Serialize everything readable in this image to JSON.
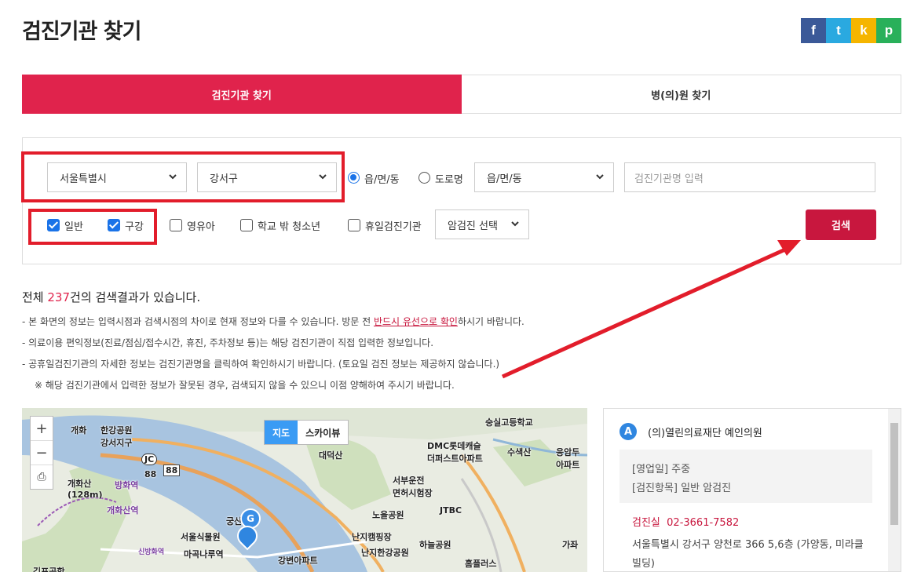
{
  "page": {
    "title": "검진기관 찾기"
  },
  "share": [
    "f",
    "t",
    "k",
    "p"
  ],
  "share_colors": {
    "facebook": "#3b5998",
    "twitter": "#2aa9e0",
    "kakaostory": "#f5b500",
    "print": "#29b05a"
  },
  "tabs": [
    {
      "label": "검진기관 찾기",
      "active": true
    },
    {
      "label": "병(의)원 찾기",
      "active": false
    }
  ],
  "search": {
    "city": "서울특별시",
    "district": "강서구",
    "addr_type_1": "읍/면/동",
    "addr_type_2": "도로명",
    "town": "읍/면/동",
    "name_placeholder": "검진기관명 입력",
    "checks": [
      {
        "label": "일반",
        "checked": true
      },
      {
        "label": "구강",
        "checked": true
      },
      {
        "label": "영유아",
        "checked": false
      },
      {
        "label": "학교 밖 청소년",
        "checked": false
      },
      {
        "label": "휴일검진기관",
        "checked": false
      }
    ],
    "cancer": "암검진 선택",
    "button": "검색"
  },
  "result": {
    "prefix": "전체 ",
    "count": "237",
    "suffix": "건의 검색결과가 있습니다."
  },
  "notes": {
    "n1_a": "- 본 화면의 정보는 입력시점과 검색시점의 차이로 현재 정보와 다를 수 있습니다.  방문 전 ",
    "n1_u": "반드시 유선으로 확인",
    "n1_b": "하시기 바랍니다.",
    "n2": "- 의료이용 편익정보(진료/점심/접수시간, 휴진, 주차정보 등)는 해당 검진기관이 직접 입력한 정보입니다.",
    "n3": "- 공휴일검진기관의 자세한 정보는 검진기관명을 클릭하여 확인하시기 바랍니다. (토요일 검진 정보는 제공하지 않습니다.)",
    "n4": "※ 해당 검진기관에서 입력한 정보가 잘못된 경우, 검색되지 않을 수 있으니 이점 양해하여 주시기 바랍니다."
  },
  "map": {
    "zoom_in": "+",
    "zoom_out": "−",
    "print": "⎙",
    "type_map": "지도",
    "type_sky": "스카이뷰",
    "labels": {
      "l1": "개화",
      "l2": "한강공원\n강서지구",
      "l3": "JC",
      "l4": "88",
      "l5": "88",
      "l6": "개화산\n(128m)",
      "l7": "개화산역",
      "l8": "방화역",
      "l9": "대덕산",
      "l10": "숭실고등학교",
      "l11": "DMC롯데캐슬\n더퍼스트아파트",
      "l12": "수색산",
      "l13": "응암두\n아파트",
      "l14": "서부운전\n면허시험장",
      "l15": "JTBC",
      "l16": "노을공원",
      "l17": "궁산",
      "l18": "서울식물원",
      "l19": "마곡나루역",
      "l20": "신방화역",
      "l21": "난지캠핑장",
      "l22": "난지한강공원",
      "l23": "하늘공원",
      "l24": "강변아파트",
      "l25": "홈플러스",
      "l26": "가좌",
      "l27": "김포공항"
    },
    "markers": [
      "G",
      "A"
    ]
  },
  "list": {
    "marker": "A",
    "name": "(의)열린의료재단 예인의원",
    "open_label": "[영업일]",
    "open_value": "주중",
    "items_label": "[검진항목]",
    "items_value": "일반 암검진",
    "room_label": "검진실",
    "room_phone": "02-3661-7582",
    "address": "서울특별시 강서구 양천로 366 5,6층 (가양동, 미라클",
    "address2": "빌딩)"
  },
  "colors": {
    "accent": "#e0234c",
    "button": "#c8173e",
    "highlight": "#e21d2b",
    "blue": "#1a73e8"
  }
}
